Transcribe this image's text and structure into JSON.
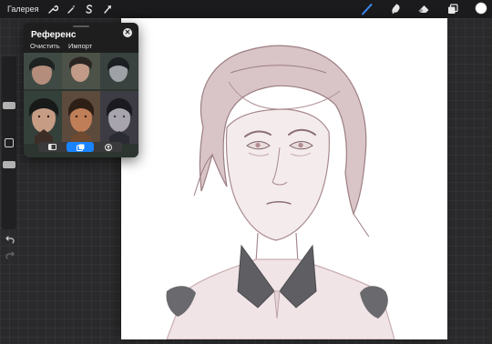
{
  "toolbar": {
    "gallery_label": "Галерея",
    "left_tools": [
      {
        "name": "wrench-icon"
      },
      {
        "name": "magic-wand-icon"
      },
      {
        "name": "selection-icon"
      },
      {
        "name": "transform-arrow-icon"
      }
    ],
    "right_tools": [
      {
        "name": "brush-icon",
        "active": true
      },
      {
        "name": "smudge-icon",
        "active": false
      },
      {
        "name": "eraser-icon",
        "active": false
      },
      {
        "name": "layers-icon",
        "active": false
      },
      {
        "name": "color-swatch",
        "active": false
      }
    ],
    "accent_color": "#3a8cff",
    "current_color": "#ffffff"
  },
  "sidebar": {
    "brush_size_level": 0.3,
    "opacity_level": 0.6,
    "buttons": [
      "modify-button",
      "undo-button",
      "redo-button"
    ]
  },
  "reference": {
    "title": "Референс",
    "clear_label": "Очистить",
    "import_label": "Импорт",
    "tabs": [
      {
        "name": "canvas-tab-icon",
        "active": false
      },
      {
        "name": "image-tab-icon",
        "active": true
      },
      {
        "name": "face-tab-icon",
        "active": false
      }
    ],
    "active_tab_color": "#1a84ff"
  },
  "canvas": {
    "background": "#ffffff",
    "sketch_stroke_color": "#8c6f74",
    "sketch_fill_color": "#c9aeb2",
    "collar_color": "#5f5f63"
  }
}
